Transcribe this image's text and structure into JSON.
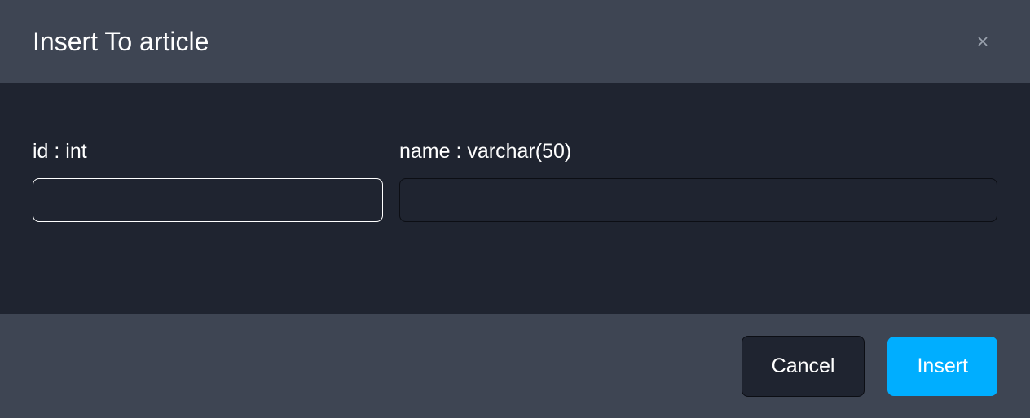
{
  "header": {
    "title": "Insert To article"
  },
  "fields": {
    "id": {
      "label": "id : int",
      "value": ""
    },
    "name": {
      "label": "name : varchar(50)",
      "value": ""
    }
  },
  "footer": {
    "cancel_label": "Cancel",
    "insert_label": "Insert"
  }
}
